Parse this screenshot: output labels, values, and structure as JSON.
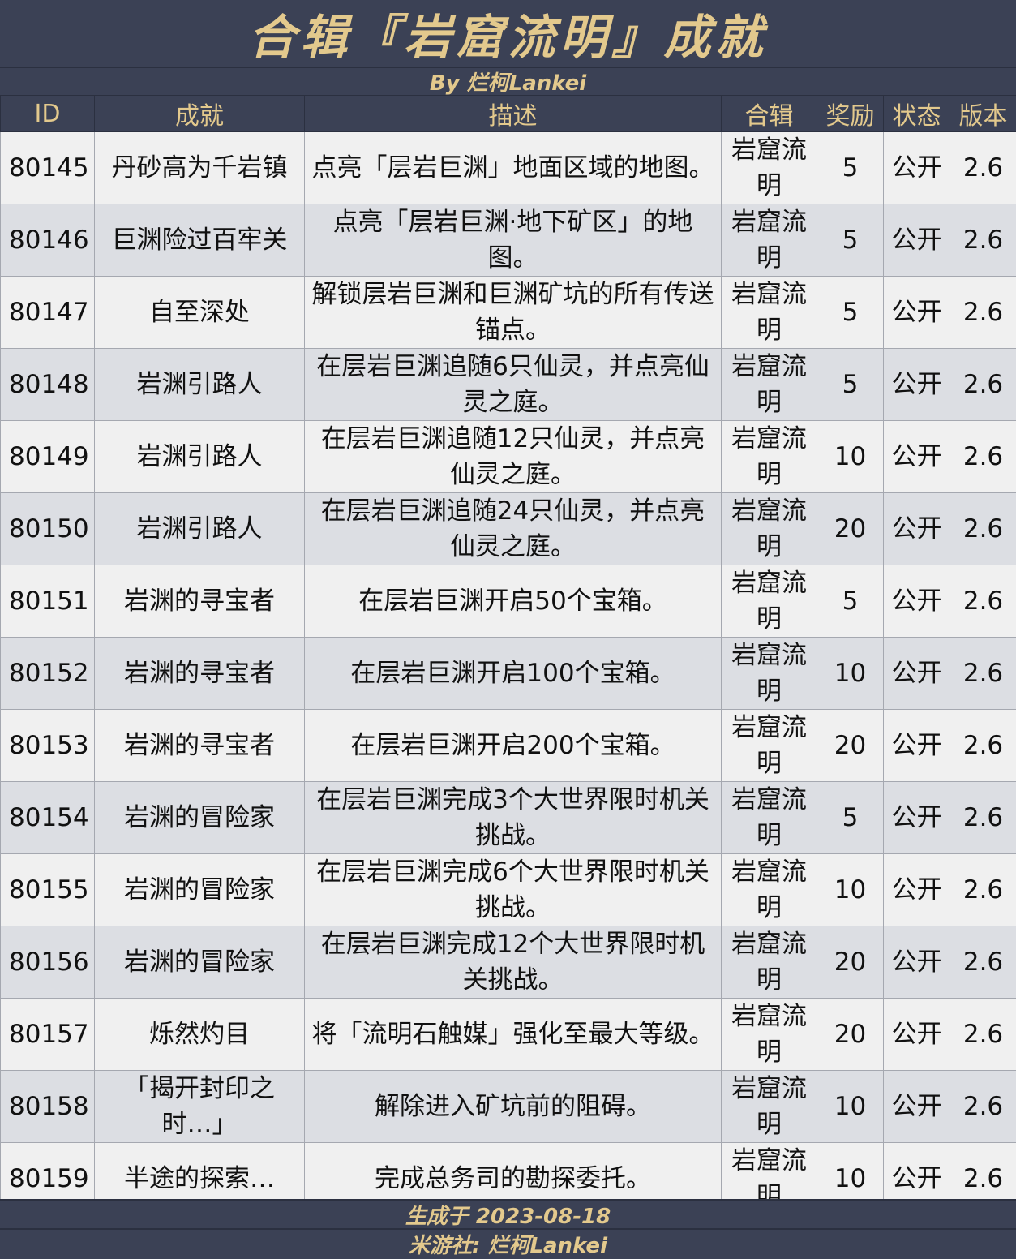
{
  "title": "合辑『岩窟流明』成就",
  "byline": "By 烂柯Lankei",
  "headers": {
    "id": "ID",
    "achievement": "成就",
    "description": "描述",
    "series": "合辑",
    "reward": "奖励",
    "status": "状态",
    "version": "版本"
  },
  "rows": [
    {
      "id": "80145",
      "name": "丹砂高为千岩镇",
      "desc": "点亮「层岩巨渊」地面区域的地图。",
      "series": "岩窟流明",
      "reward": "5",
      "status": "公开",
      "version": "2.6"
    },
    {
      "id": "80146",
      "name": "巨渊险过百牢关",
      "desc": "点亮「层岩巨渊·地下矿区」的地图。",
      "series": "岩窟流明",
      "reward": "5",
      "status": "公开",
      "version": "2.6"
    },
    {
      "id": "80147",
      "name": "自至深处",
      "desc": "解锁层岩巨渊和巨渊矿坑的所有传送锚点。",
      "series": "岩窟流明",
      "reward": "5",
      "status": "公开",
      "version": "2.6"
    },
    {
      "id": "80148",
      "name": "岩渊引路人",
      "desc": "在层岩巨渊追随6只仙灵，并点亮仙灵之庭。",
      "series": "岩窟流明",
      "reward": "5",
      "status": "公开",
      "version": "2.6"
    },
    {
      "id": "80149",
      "name": "岩渊引路人",
      "desc": "在层岩巨渊追随12只仙灵，并点亮仙灵之庭。",
      "series": "岩窟流明",
      "reward": "10",
      "status": "公开",
      "version": "2.6"
    },
    {
      "id": "80150",
      "name": "岩渊引路人",
      "desc": "在层岩巨渊追随24只仙灵，并点亮仙灵之庭。",
      "series": "岩窟流明",
      "reward": "20",
      "status": "公开",
      "version": "2.6"
    },
    {
      "id": "80151",
      "name": "岩渊的寻宝者",
      "desc": "在层岩巨渊开启50个宝箱。",
      "series": "岩窟流明",
      "reward": "5",
      "status": "公开",
      "version": "2.6"
    },
    {
      "id": "80152",
      "name": "岩渊的寻宝者",
      "desc": "在层岩巨渊开启100个宝箱。",
      "series": "岩窟流明",
      "reward": "10",
      "status": "公开",
      "version": "2.6"
    },
    {
      "id": "80153",
      "name": "岩渊的寻宝者",
      "desc": "在层岩巨渊开启200个宝箱。",
      "series": "岩窟流明",
      "reward": "20",
      "status": "公开",
      "version": "2.6"
    },
    {
      "id": "80154",
      "name": "岩渊的冒险家",
      "desc": "在层岩巨渊完成3个大世界限时机关挑战。",
      "series": "岩窟流明",
      "reward": "5",
      "status": "公开",
      "version": "2.6"
    },
    {
      "id": "80155",
      "name": "岩渊的冒险家",
      "desc": "在层岩巨渊完成6个大世界限时机关挑战。",
      "series": "岩窟流明",
      "reward": "10",
      "status": "公开",
      "version": "2.6"
    },
    {
      "id": "80156",
      "name": "岩渊的冒险家",
      "desc": "在层岩巨渊完成12个大世界限时机关挑战。",
      "series": "岩窟流明",
      "reward": "20",
      "status": "公开",
      "version": "2.6"
    },
    {
      "id": "80157",
      "name": "烁然灼目",
      "desc": "将「流明石触媒」强化至最大等级。",
      "series": "岩窟流明",
      "reward": "20",
      "status": "公开",
      "version": "2.6"
    },
    {
      "id": "80158",
      "name": "「揭开封印之时…」",
      "desc": "解除进入矿坑前的阻碍。",
      "series": "岩窟流明",
      "reward": "10",
      "status": "公开",
      "version": "2.6"
    },
    {
      "id": "80159",
      "name": "半途的探索…",
      "desc": "完成总务司的勘探委托。",
      "series": "岩窟流明",
      "reward": "10",
      "status": "公开",
      "version": "2.6"
    }
  ],
  "footer": {
    "generated": "生成于 2023-08-18",
    "source": "米游社: 烂柯Lankei"
  },
  "colors": {
    "header_bg": "#3b4155",
    "gold": "#e3c98d",
    "row_light": "#f0f0f0",
    "row_dark": "#dcdee3"
  }
}
